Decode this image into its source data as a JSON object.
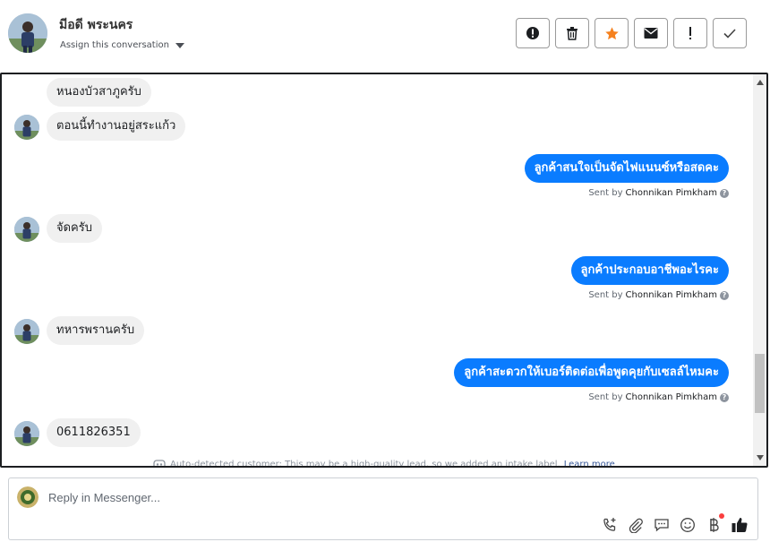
{
  "header": {
    "contact_name": "มีอดี พระนคร",
    "assign_label": "Assign this conversation",
    "actions": [
      {
        "name": "spam-button",
        "icon": "alert-circle-icon"
      },
      {
        "name": "delete-button",
        "icon": "trash-icon"
      },
      {
        "name": "star-button",
        "icon": "star-icon"
      },
      {
        "name": "mark-unread-button",
        "icon": "envelope-icon"
      },
      {
        "name": "follow-up-button",
        "icon": "exclamation-icon"
      },
      {
        "name": "mark-done-button",
        "icon": "check-icon"
      }
    ]
  },
  "messages": [
    {
      "direction": "in",
      "text": "หนองบัวสาภูครับ"
    },
    {
      "direction": "in",
      "text": "ตอนนี้ทำงานอยู่สระแก้ว"
    },
    {
      "direction": "out",
      "text": "ลูกค้าสนใจเป็นจัดไฟแนนซ์หรือสดคะ",
      "sent_by_prefix": "Sent by",
      "sender": "Chonnikan Pimkham"
    },
    {
      "direction": "in",
      "text": "จัดครับ"
    },
    {
      "direction": "out",
      "text": "ลูกค้าประกอบอาชีพอะไรคะ",
      "sent_by_prefix": "Sent by",
      "sender": "Chonnikan Pimkham"
    },
    {
      "direction": "in",
      "text": "ทหารพรานครับ"
    },
    {
      "direction": "out",
      "text": "ลูกค้าสะดวกให้เบอร์ติดต่อเพื่อพูดคุยกับเซลล์ไหมคะ",
      "sent_by_prefix": "Sent by",
      "sender": "Chonnikan Pimkham"
    },
    {
      "direction": "in",
      "text": "0611826351"
    }
  ],
  "auto_detect": {
    "text": "Auto-detected customer: This may be a high-quality lead, so we added an intake label.",
    "link": "Learn more"
  },
  "composer": {
    "placeholder": "Reply in Messenger...",
    "tools": [
      "phone-add-icon",
      "attachment-icon",
      "saved-replies-icon",
      "emoji-icon",
      "payment-icon",
      "thumbs-up-icon"
    ]
  },
  "colors": {
    "outgoing_bubble": "#0a7cff",
    "incoming_bubble": "#f0f0f0",
    "star": "#f5811f"
  }
}
